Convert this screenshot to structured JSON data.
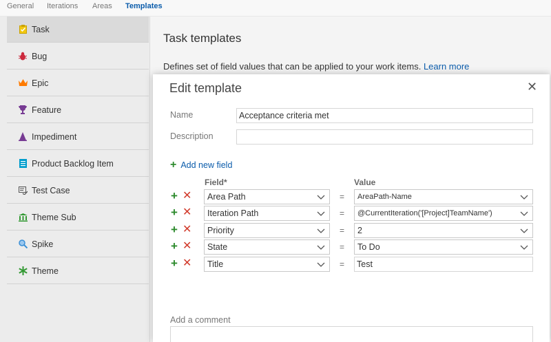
{
  "tabs": [
    {
      "label": "General"
    },
    {
      "label": "Iterations"
    },
    {
      "label": "Areas"
    },
    {
      "label": "Templates"
    }
  ],
  "sidebar": {
    "items": [
      {
        "label": "Task",
        "icon": "clipboard-icon",
        "color": "#f2c811"
      },
      {
        "label": "Bug",
        "icon": "bug-icon",
        "color": "#cc293d"
      },
      {
        "label": "Epic",
        "icon": "crown-icon",
        "color": "#ff7b00"
      },
      {
        "label": "Feature",
        "icon": "trophy-icon",
        "color": "#773b93"
      },
      {
        "label": "Impediment",
        "icon": "pyramid-icon",
        "color": "#773b93"
      },
      {
        "label": "Product Backlog Item",
        "icon": "backlog-icon",
        "color": "#009ccc"
      },
      {
        "label": "Test Case",
        "icon": "test-case-icon",
        "color": "#555555"
      },
      {
        "label": "Theme Sub",
        "icon": "pillars-icon",
        "color": "#339933"
      },
      {
        "label": "Spike",
        "icon": "magnifier-icon",
        "color": "#3a8fd6"
      },
      {
        "label": "Theme",
        "icon": "asterisk-icon",
        "color": "#339933"
      }
    ]
  },
  "main": {
    "title": "Task templates",
    "description": "Defines set of field values that can be applied to your work items.",
    "learn_more": "Learn more"
  },
  "modal": {
    "title": "Edit template",
    "name_label": "Name",
    "name_value": "Acceptance criteria met",
    "description_label": "Description",
    "description_value": "",
    "add_field_label": "Add new field",
    "field_header": "Field*",
    "value_header": "Value",
    "equals": "=",
    "rows": [
      {
        "field": "Area Path",
        "value": "AreaPath-Name",
        "value_type": "select"
      },
      {
        "field": "Iteration Path",
        "value": "@CurrentIteration('[Project]TeamName')",
        "value_type": "select"
      },
      {
        "field": "Priority",
        "value": "2",
        "value_type": "select"
      },
      {
        "field": "State",
        "value": "To Do",
        "value_type": "select"
      },
      {
        "field": "Title",
        "value": "Test",
        "value_type": "text"
      }
    ],
    "comment_label": "Add a comment"
  },
  "colors": {
    "accent": "#0b5cab",
    "add": "#2c8a2c",
    "remove": "#d13a2b"
  }
}
